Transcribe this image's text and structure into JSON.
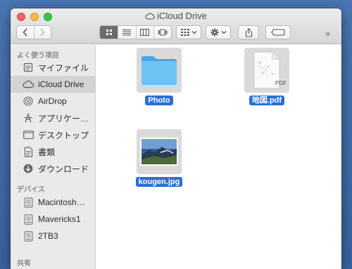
{
  "window": {
    "title": "iCloud Drive"
  },
  "toolbar": {
    "overflow": "»"
  },
  "sidebar": {
    "favorites_header": "よく使う項目",
    "favorites": [
      {
        "label": "マイファイル",
        "icon": "my-files-icon"
      },
      {
        "label": "iCloud Drive",
        "icon": "icloud-icon"
      },
      {
        "label": "AirDrop",
        "icon": "airdrop-icon"
      },
      {
        "label": "アプリケー…",
        "icon": "applications-icon"
      },
      {
        "label": "デスクトップ",
        "icon": "desktop-icon"
      },
      {
        "label": "書類",
        "icon": "documents-icon"
      },
      {
        "label": "ダウンロード",
        "icon": "downloads-icon"
      }
    ],
    "devices_header": "デバイス",
    "devices": [
      {
        "label": "Macintosh…",
        "icon": "disk-icon"
      },
      {
        "label": "Mavericks1",
        "icon": "disk-icon"
      },
      {
        "label": "2TB3",
        "icon": "disk-icon"
      }
    ],
    "shared_header": "共有"
  },
  "files": [
    {
      "name": "Photo",
      "kind": "folder"
    },
    {
      "name": "地図.pdf",
      "kind": "pdf",
      "badge": "PDF"
    },
    {
      "name": "kougen.jpg",
      "kind": "image"
    }
  ],
  "colors": {
    "selection": "#2a6ed8",
    "folder": "#5ab8f0"
  }
}
